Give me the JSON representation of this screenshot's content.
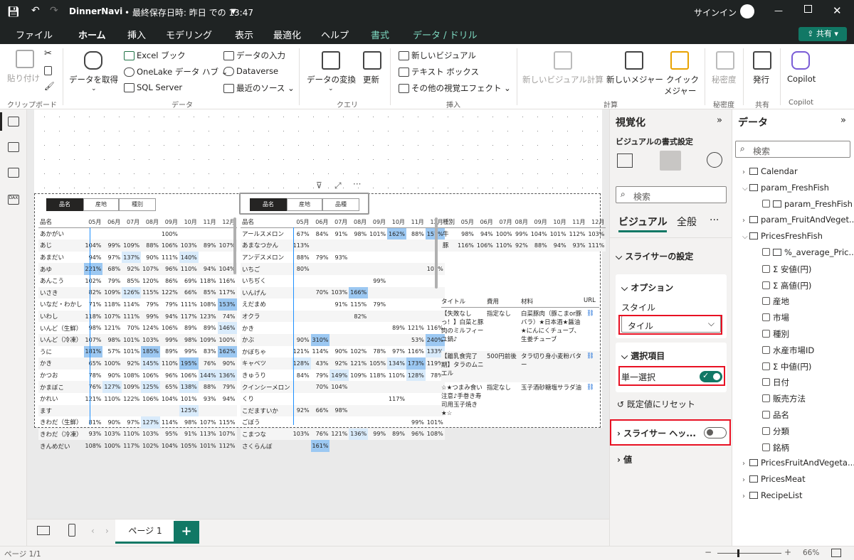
{
  "titlebar": {
    "filename": "DinnerNavi",
    "saved": "• 最終保存日時: 昨日 での 13:47",
    "signin": "サインイン"
  },
  "tabs": [
    {
      "label": "ファイル"
    },
    {
      "label": "ホーム"
    },
    {
      "label": "挿入"
    },
    {
      "label": "モデリング"
    },
    {
      "label": "表示"
    },
    {
      "label": "最適化"
    },
    {
      "label": "ヘルプ"
    },
    {
      "label": "書式"
    },
    {
      "label": "データ / ドリル"
    }
  ],
  "share_label": "共有",
  "ribbon": {
    "paste": "貼り付け",
    "clipboard": "クリップボード",
    "get_data": "データを取得",
    "excel": "Excel ブック",
    "onelake": "OneLake データ ハブ",
    "sql": "SQL Server",
    "enter_data": "データの入力",
    "dataverse": "Dataverse",
    "recent": "最近のソース",
    "data_group": "データ",
    "transform": "データの変換",
    "refresh": "更新",
    "query_group": "クエリ",
    "new_visual": "新しいビジュアル",
    "textbox": "テキスト ボックス",
    "more_visuals": "その他の視覚エフェクト",
    "insert_group": "挿入",
    "new_calc": "新しいビジュアル計算",
    "new_measure": "新しいメジャー",
    "quick_measure": "クイック",
    "quick_measure2": "メジャー",
    "calc_group": "計算",
    "sensitivity": "秘密度",
    "sensitivity_group": "秘密度",
    "publish": "発行",
    "share_group": "共有",
    "copilot": "Copilot",
    "copilot_group": "Copilot"
  },
  "slicers": {
    "left": [
      "品名",
      "産地",
      "種別"
    ],
    "mid": [
      "品名",
      "産地",
      "品種"
    ]
  },
  "matrix1": {
    "header_name": "品名",
    "months": [
      "05月",
      "06月",
      "07月",
      "08月",
      "09月",
      "10月",
      "11月",
      "12月"
    ],
    "rows": [
      {
        "n": "あかがい",
        "v": [
          "",
          "",
          "",
          "",
          "100%",
          "",
          "",
          ""
        ]
      },
      {
        "n": "あじ",
        "v": [
          "104%",
          "99%",
          "109%",
          "88%",
          "106%",
          "103%",
          "89%",
          "107%"
        ]
      },
      {
        "n": "あまだい",
        "v": [
          "94%",
          "97%",
          "137%",
          "90%",
          "111%",
          "140%",
          "",
          ""
        ]
      },
      {
        "n": "あゆ",
        "v": [
          "221%",
          "68%",
          "92%",
          "107%",
          "96%",
          "110%",
          "94%",
          "104%"
        ]
      },
      {
        "n": "あんこう",
        "v": [
          "102%",
          "79%",
          "85%",
          "120%",
          "86%",
          "69%",
          "118%",
          "116%"
        ]
      },
      {
        "n": "いさき",
        "v": [
          "82%",
          "109%",
          "126%",
          "115%",
          "122%",
          "66%",
          "85%",
          "117%"
        ]
      },
      {
        "n": "いなだ・わかし",
        "v": [
          "71%",
          "118%",
          "114%",
          "79%",
          "79%",
          "111%",
          "108%",
          "153%"
        ]
      },
      {
        "n": "いわし",
        "v": [
          "118%",
          "107%",
          "111%",
          "99%",
          "94%",
          "117%",
          "123%",
          "74%"
        ]
      },
      {
        "n": "いんど（生鮮）",
        "v": [
          "98%",
          "121%",
          "70%",
          "124%",
          "106%",
          "89%",
          "89%",
          "146%"
        ]
      },
      {
        "n": "いんど（冷凍）",
        "v": [
          "107%",
          "98%",
          "101%",
          "103%",
          "99%",
          "98%",
          "109%",
          "100%"
        ]
      },
      {
        "n": "うに",
        "v": [
          "181%",
          "57%",
          "101%",
          "185%",
          "89%",
          "99%",
          "83%",
          "162%"
        ]
      },
      {
        "n": "かき",
        "v": [
          "65%",
          "100%",
          "92%",
          "145%",
          "110%",
          "195%",
          "76%",
          "90%"
        ]
      },
      {
        "n": "かつお",
        "v": [
          "78%",
          "90%",
          "108%",
          "106%",
          "96%",
          "106%",
          "144%",
          "136%"
        ]
      },
      {
        "n": "かまぼこ",
        "v": [
          "76%",
          "127%",
          "109%",
          "125%",
          "65%",
          "138%",
          "88%",
          "79%"
        ]
      },
      {
        "n": "かれい",
        "v": [
          "121%",
          "110%",
          "122%",
          "106%",
          "104%",
          "101%",
          "93%",
          "94%"
        ]
      },
      {
        "n": "ます",
        "v": [
          "",
          "",
          "",
          "",
          "",
          "125%",
          "",
          ""
        ]
      },
      {
        "n": "きわだ（生鮮）",
        "v": [
          "81%",
          "90%",
          "97%",
          "127%",
          "114%",
          "98%",
          "107%",
          "115%"
        ]
      },
      {
        "n": "きわだ（冷凍）",
        "v": [
          "93%",
          "103%",
          "110%",
          "103%",
          "95%",
          "91%",
          "113%",
          "107%"
        ]
      },
      {
        "n": "きんめだい",
        "v": [
          "108%",
          "100%",
          "117%",
          "102%",
          "104%",
          "105%",
          "101%",
          "112%"
        ]
      }
    ]
  },
  "matrix2": {
    "header_name": "品名",
    "months": [
      "05月",
      "06月",
      "07月",
      "08月",
      "09月",
      "10月",
      "11月",
      "12月"
    ],
    "rows": [
      {
        "n": "アールスメロン",
        "v": [
          "67%",
          "84%",
          "91%",
          "98%",
          "101%",
          "162%",
          "88%",
          "157%"
        ]
      },
      {
        "n": "あまなつかん",
        "v": [
          "113%",
          "",
          "",
          "",
          "",
          "",
          "",
          ""
        ]
      },
      {
        "n": "アンデスメロン",
        "v": [
          "88%",
          "79%",
          "93%",
          "",
          "",
          "",
          "",
          ""
        ]
      },
      {
        "n": "いちご",
        "v": [
          "80%",
          "",
          "",
          "",
          "",
          "",
          "",
          "101%"
        ]
      },
      {
        "n": "いちぢく",
        "v": [
          "",
          "",
          "",
          "",
          "99%",
          "",
          "",
          ""
        ]
      },
      {
        "n": "いんげん",
        "v": [
          "",
          "70%",
          "103%",
          "166%",
          "",
          "",
          "",
          ""
        ]
      },
      {
        "n": "えだまめ",
        "v": [
          "",
          "",
          "91%",
          "115%",
          "79%",
          "",
          "",
          ""
        ]
      },
      {
        "n": "オクラ",
        "v": [
          "",
          "",
          "",
          "82%",
          "",
          "",
          "",
          ""
        ]
      },
      {
        "n": "かき",
        "v": [
          "",
          "",
          "",
          "",
          "",
          "89%",
          "121%",
          "116%"
        ]
      },
      {
        "n": "かぶ",
        "v": [
          "90%",
          "310%",
          "",
          "",
          "",
          "",
          "53%",
          "240%"
        ]
      },
      {
        "n": "かぼちゃ",
        "v": [
          "121%",
          "114%",
          "90%",
          "102%",
          "78%",
          "97%",
          "116%",
          "133%"
        ]
      },
      {
        "n": "キャベツ",
        "v": [
          "128%",
          "43%",
          "92%",
          "121%",
          "105%",
          "134%",
          "173%",
          "119%"
        ]
      },
      {
        "n": "きゅうり",
        "v": [
          "84%",
          "79%",
          "149%",
          "109%",
          "118%",
          "110%",
          "128%",
          "78%"
        ]
      },
      {
        "n": "クインシーメロン",
        "v": [
          "",
          "70%",
          "104%",
          "",
          "",
          "",
          "",
          ""
        ]
      },
      {
        "n": "くり",
        "v": [
          "",
          "",
          "",
          "",
          "",
          "117%",
          "",
          ""
        ]
      },
      {
        "n": "こだますいか",
        "v": [
          "92%",
          "66%",
          "98%",
          "",
          "",
          "",
          "",
          ""
        ]
      },
      {
        "n": "ごぼう",
        "v": [
          "",
          "",
          "",
          "",
          "",
          "",
          "99%",
          "101%"
        ]
      },
      {
        "n": "こまつな",
        "v": [
          "103%",
          "76%",
          "121%",
          "136%",
          "99%",
          "89%",
          "96%",
          "108%"
        ]
      },
      {
        "n": "さくらんぼ",
        "v": [
          "",
          "161%",
          "",
          "",
          "",
          "",
          "",
          ""
        ]
      }
    ]
  },
  "matrix3": {
    "header_name": "種別",
    "months": [
      "05月",
      "06月",
      "07月",
      "08月",
      "09月",
      "10月",
      "11月",
      "12月"
    ],
    "rows": [
      {
        "n": "牛",
        "v": [
          "98%",
          "94%",
          "100%",
          "99%",
          "104%",
          "101%",
          "112%",
          "103%"
        ]
      },
      {
        "n": "豚",
        "v": [
          "116%",
          "106%",
          "110%",
          "92%",
          "88%",
          "94%",
          "93%",
          "111%"
        ]
      }
    ]
  },
  "recipes": {
    "headers": [
      "タイトル",
      "費用",
      "材料",
      "URL"
    ],
    "rows": [
      {
        "title": "【失敗なしっ！】白菜と豚肉のミルフィーユ鍋♪",
        "cost": "指定なし",
        "mat": "白菜豚肉（豚こまor豚バラ）★日本酒★醤油★にんにくチューブ、生姜チューブ"
      },
      {
        "title": "【離乳食完了期】タラのムニエル",
        "cost": "500円前後",
        "mat": "タラ切り身小麦粉バター"
      },
      {
        "title": "☆★つまみ食い注意♪手巻き寿司用玉子焼き★☆",
        "cost": "指定なし",
        "mat": "玉子酒砂糖塩サラダ油"
      }
    ]
  },
  "viz": {
    "title": "視覚化",
    "subtitle": "ビジュアルの書式設定",
    "search_placeholder": "検索",
    "tab_visual": "ビジュアル",
    "tab_general": "全般",
    "more": "···",
    "slicer_settings": "スライサーの設定",
    "options": "オプション",
    "style_label": "スタイル",
    "style_value": "タイル",
    "selection": "選択項目",
    "single_select": "単一選択",
    "reset": "既定値にリセット",
    "slicer_header": "スライサー ヘッ...",
    "values": "値"
  },
  "datapanel": {
    "title": "データ",
    "search_placeholder": "検索",
    "items": [
      {
        "label": "Calendar",
        "kind": "table",
        "level": 0
      },
      {
        "label": "param_FreshFish",
        "kind": "table",
        "level": 0,
        "open": true
      },
      {
        "label": "param_FreshFish",
        "kind": "field",
        "level": 1
      },
      {
        "label": "param_FruitAndVeget...",
        "kind": "table",
        "level": 0
      },
      {
        "label": "PricesFreshFish",
        "kind": "table",
        "level": 0,
        "open": true
      },
      {
        "label": "%_average_Pric...",
        "kind": "measure",
        "level": 1
      },
      {
        "label": "安値(円)",
        "kind": "sum",
        "level": 1
      },
      {
        "label": "高値(円)",
        "kind": "sum",
        "level": 1
      },
      {
        "label": "産地",
        "kind": "field",
        "level": 1
      },
      {
        "label": "市場",
        "kind": "field",
        "level": 1
      },
      {
        "label": "種別",
        "kind": "field",
        "level": 1
      },
      {
        "label": "水産市場ID",
        "kind": "field",
        "level": 1
      },
      {
        "label": "中値(円)",
        "kind": "sum",
        "level": 1
      },
      {
        "label": "日付",
        "kind": "field",
        "level": 1
      },
      {
        "label": "販売方法",
        "kind": "field",
        "level": 1
      },
      {
        "label": "品名",
        "kind": "field",
        "level": 1
      },
      {
        "label": "分類",
        "kind": "field",
        "level": 1
      },
      {
        "label": "銘柄",
        "kind": "field",
        "level": 1
      },
      {
        "label": "PricesFruitAndVegeta...",
        "kind": "table",
        "level": 0
      },
      {
        "label": "PricesMeat",
        "kind": "table",
        "level": 0
      },
      {
        "label": "RecipeList",
        "kind": "table",
        "level": 0
      }
    ]
  },
  "bottom": {
    "page_tab": "ページ 1",
    "add": "+"
  },
  "status": {
    "page": "ページ 1/1",
    "zoom": "66%"
  },
  "colors": {
    "accent": "#117865",
    "heat_strong": "#9cc8f2",
    "heat_light": "#d9ebfb",
    "redbox": "#e81123"
  }
}
